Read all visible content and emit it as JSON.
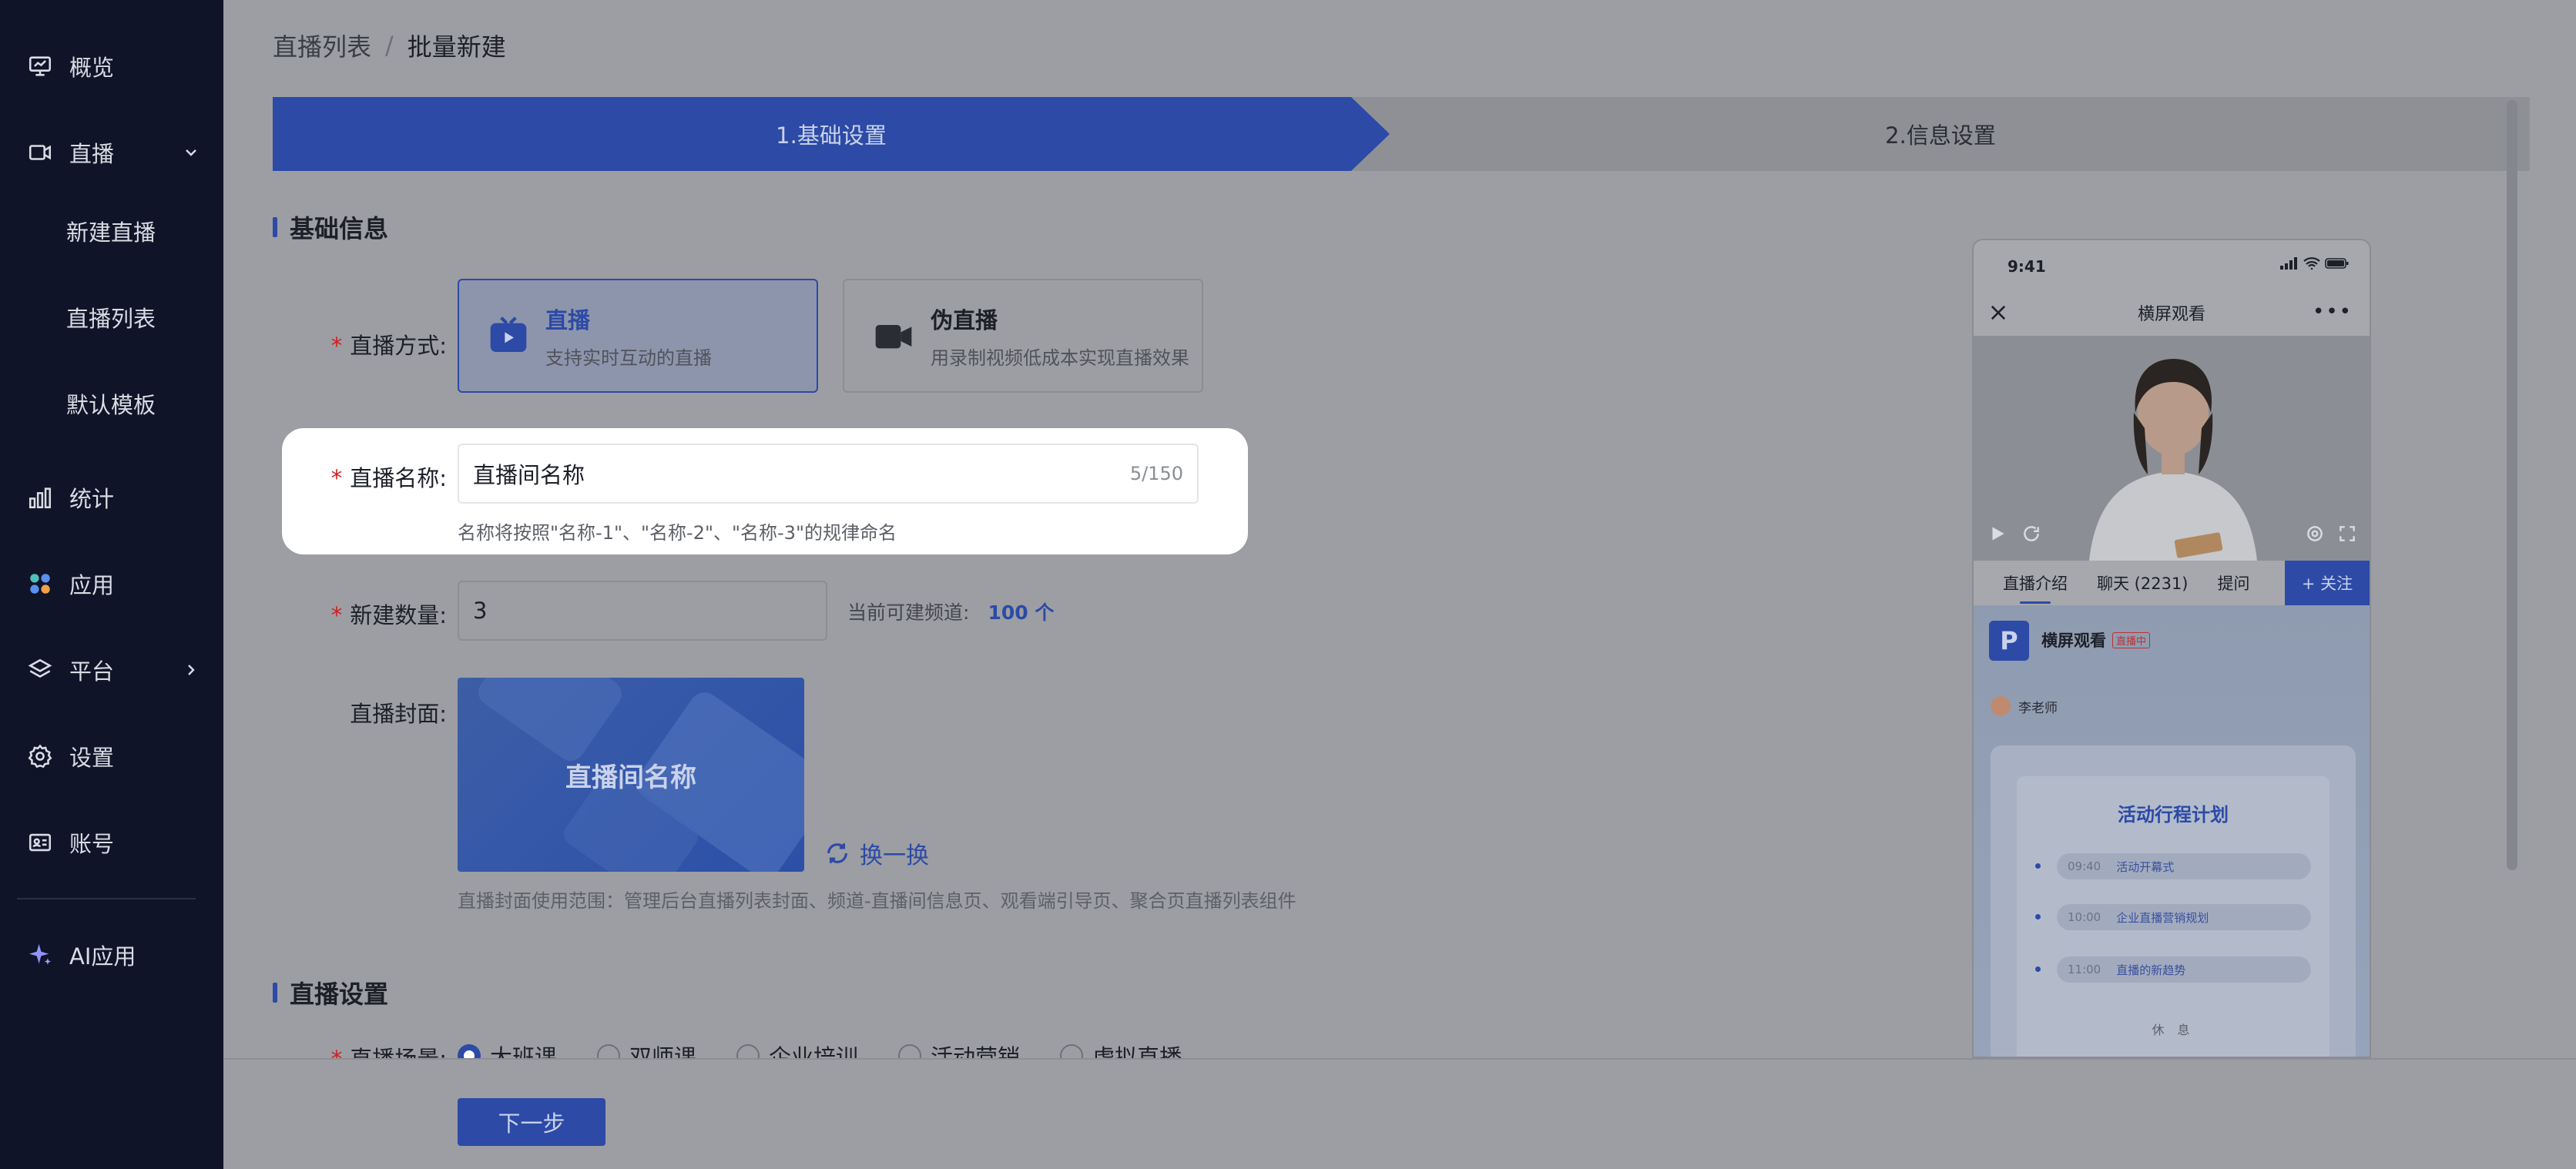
{
  "sidebar": {
    "items": [
      {
        "label": "概览",
        "icon": "monitor-icon"
      },
      {
        "label": "直播",
        "icon": "live-icon"
      },
      {
        "label": "统计",
        "icon": "stats-icon"
      },
      {
        "label": "应用",
        "icon": "apps-icon"
      },
      {
        "label": "平台",
        "icon": "layers-icon"
      },
      {
        "label": "设置",
        "icon": "gear-icon"
      },
      {
        "label": "账号",
        "icon": "id-card-icon"
      },
      {
        "label": "AI应用",
        "icon": "sparkle-icon"
      }
    ],
    "sub_items": [
      "新建直播",
      "直播列表",
      "默认模板"
    ]
  },
  "breadcrumb": {
    "parent": "直播列表",
    "separator": "/",
    "current": "批量新建"
  },
  "steps": [
    "1.基础设置",
    "2.信息设置"
  ],
  "sections": {
    "basic": "基础信息",
    "settings": "直播设置"
  },
  "form": {
    "mode_label": "直播方式:",
    "modes": [
      {
        "title": "直播",
        "desc": "支持实时互动的直播"
      },
      {
        "title": "伪直播",
        "desc": "用录制视频低成本实现直播效果"
      }
    ],
    "name_label": "直播名称:",
    "name_value": "直播间名称",
    "name_count": "5/150",
    "name_hint": "名称将按照\"名称-1\"、\"名称-2\"、\"名称-3\"的规律命名",
    "qty_label": "新建数量:",
    "qty_value": "3",
    "qty_note_label": "当前可建频道:",
    "qty_note_value": "100 个",
    "cover_label": "直播封面:",
    "cover_title": "直播间名称",
    "swap_label": "换一换",
    "cover_hint": "直播封面使用范围：管理后台直播列表封面、频道-直播间信息页、观看端引导页、聚合页直播列表组件",
    "scene_label": "直播场景:",
    "scenes": [
      "大班课",
      "双师课",
      "企业培训",
      "活动营销",
      "虚拟直播"
    ]
  },
  "footer": {
    "next_label": "下一步"
  },
  "preview": {
    "time": "9:41",
    "nav_title": "横屏观看",
    "tabs": [
      "直播介绍",
      "聊天 (2231)",
      "提问"
    ],
    "follow": "+ 关注",
    "logo": "P",
    "title": "横屏观看",
    "badge": "直播中",
    "teacher": "李老师",
    "card_title": "活动行程计划",
    "schedule": [
      {
        "time": "09:40",
        "text": "活动开幕式"
      },
      {
        "time": "10:00",
        "text": "企业直播营销规划"
      },
      {
        "time": "11:00",
        "text": "直播的新趋势"
      }
    ],
    "rest": "休 息"
  },
  "colors": {
    "sidebar_bg": "#0f1428",
    "accent": "#2c4aa6",
    "required": "#c22"
  }
}
